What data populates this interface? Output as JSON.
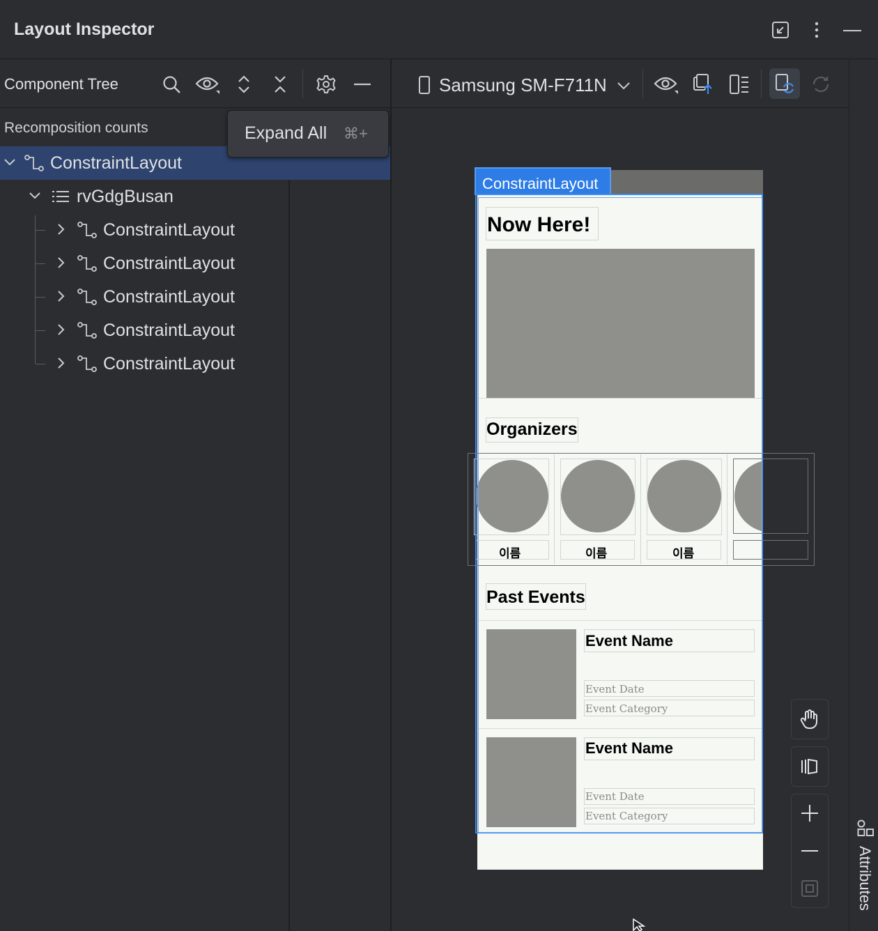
{
  "window": {
    "title": "Layout Inspector"
  },
  "component_tree": {
    "label": "Component Tree",
    "recomposition_label": "Recomposition counts",
    "tooltip": {
      "text": "Expand All",
      "shortcut": "⌘+"
    },
    "nodes": [
      {
        "label": "ConstraintLayout",
        "type": "constraint",
        "expanded": true,
        "selected": true
      },
      {
        "label": "rvGdgBusan",
        "type": "recycler",
        "expanded": true,
        "selected": false
      },
      {
        "label": "ConstraintLayout",
        "type": "constraint",
        "expanded": false,
        "selected": false
      },
      {
        "label": "ConstraintLayout",
        "type": "constraint",
        "expanded": false,
        "selected": false
      },
      {
        "label": "ConstraintLayout",
        "type": "constraint",
        "expanded": false,
        "selected": false
      },
      {
        "label": "ConstraintLayout",
        "type": "constraint",
        "expanded": false,
        "selected": false
      },
      {
        "label": "ConstraintLayout",
        "type": "constraint",
        "expanded": false,
        "selected": false
      }
    ]
  },
  "toolbar": {
    "device": "Samsung SM-F711N"
  },
  "preview": {
    "selection_tag": "ConstraintLayout",
    "now_here": "Now Here!",
    "organizers": "Organizers",
    "organizer_names": [
      "이름",
      "이름",
      "이름"
    ],
    "past_events": "Past Events",
    "events": [
      {
        "name": "Event Name",
        "date": "Event Date",
        "category": "Event Category"
      },
      {
        "name": "Event Name",
        "date": "Event Date",
        "category": "Event Category"
      }
    ]
  },
  "side_panel": {
    "attributes_label": "Attributes"
  },
  "colors": {
    "background": "#2b2d30",
    "selection": "#2e436e",
    "accent": "#3d8bf0",
    "placeholder": "#8f908c"
  }
}
